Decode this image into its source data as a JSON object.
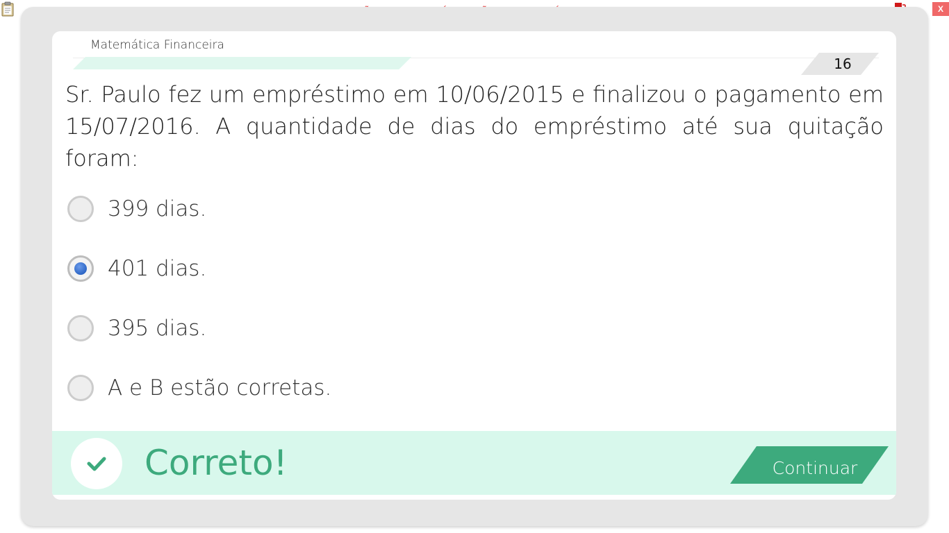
{
  "window": {
    "banner_text": "VERSÃO PARA FUNCIONÁRIOS - NÃO COMERCIALIZÁVEL",
    "close_label": "X"
  },
  "card": {
    "subject": "Matemática Financeira",
    "question_number": "16",
    "progress_fraction": 0.42,
    "question_text": "Sr. Paulo fez um empréstimo em 10/06/2015 e finalizou o pagamento em 15/07/2016.  A quantidade de dias do empréstimo até sua quitação foram:"
  },
  "options": [
    {
      "label": "399 dias.",
      "selected": false
    },
    {
      "label": "401 dias.",
      "selected": true
    },
    {
      "label": "395 dias.",
      "selected": false
    },
    {
      "label": "A e B estão corretas.",
      "selected": false
    }
  ],
  "feedback": {
    "text": "Correto!",
    "continue_label": "Continuar"
  },
  "colors": {
    "accent_green": "#3daa7d",
    "feedback_background": "#d8f8ec",
    "progress_fill": "#dff7ee",
    "radio_selected": "#2d66c6",
    "banner_red": "#e84a4a"
  },
  "icons": {
    "top_left": "clipboard-icon",
    "top_right": "network-monitor-icon",
    "feedback": "checkmark-icon"
  }
}
